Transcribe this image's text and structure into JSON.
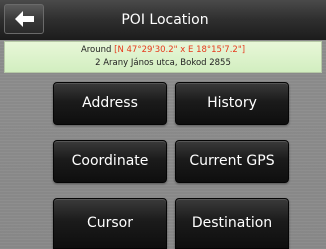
{
  "header": {
    "title": "POI Location",
    "back_icon": "arrow-left-icon"
  },
  "info": {
    "prefix": "Around",
    "coords": "[N 47°29'30.2\" x E 18°15'7.2\"]",
    "address": "2 Arany János utca, Bokod 2855",
    "colors": {
      "background": "#d9f0c6",
      "coords": "#e63a1c"
    }
  },
  "buttons": {
    "address": "Address",
    "history": "History",
    "coordinate": "Coordinate",
    "current_gps": "Current GPS",
    "cursor": "Cursor",
    "destination": "Destination"
  }
}
